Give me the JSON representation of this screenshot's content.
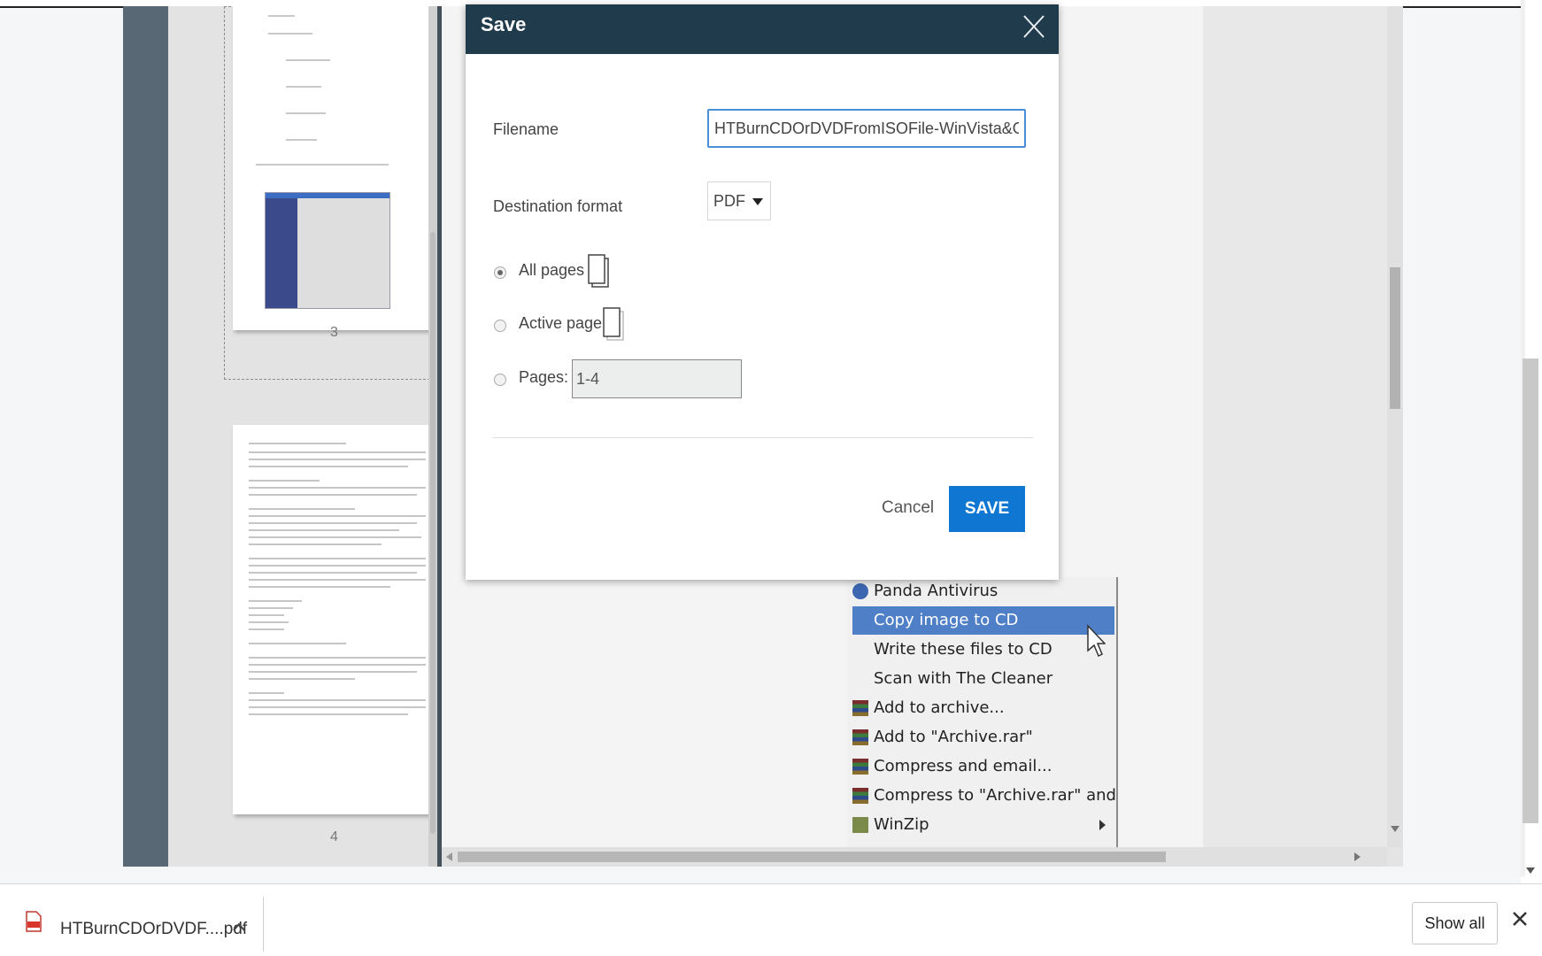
{
  "dialog": {
    "title": "Save",
    "filename_label": "Filename",
    "filename_value": "HTBurnCDOrDVDFromISOFile-WinVista&OlderOpSy",
    "format_label": "Destination format",
    "format_value": "PDF",
    "options": [
      {
        "label": "All pages",
        "selected": true
      },
      {
        "label": "Active page",
        "selected": false
      },
      {
        "label": "Pages:",
        "selected": false
      }
    ],
    "pages_value": "1-4",
    "cancel_label": "Cancel",
    "save_label": "SAVE"
  },
  "thumbnails": {
    "page3": "3",
    "page4": "4"
  },
  "context_menu": {
    "items": [
      {
        "label": "Panda Antivirus",
        "icon": "panda-icon"
      },
      {
        "label": "Copy image to CD",
        "highlighted": true
      },
      {
        "label": "Write these files to CD"
      },
      {
        "label": "Scan with The Cleaner"
      },
      {
        "label": "Add to archive...",
        "icon": "winrar-icon"
      },
      {
        "label": "Add to \"Archive.rar\"",
        "icon": "winrar-icon"
      },
      {
        "label": "Compress and email...",
        "icon": "winrar-icon"
      },
      {
        "label": "Compress to \"Archive.rar\" and email",
        "icon": "winrar-icon"
      },
      {
        "label": "WinZip",
        "icon": "winzip-icon",
        "submenu": true
      }
    ]
  },
  "download_bar": {
    "file_name": "HTBurnCDOrDVDF....pdf",
    "show_all_label": "Show all"
  },
  "colors": {
    "dialog_header": "#203c4c",
    "save_button": "#0f76d1",
    "input_focus": "#4a8fd8",
    "menu_highlight": "#4f7fc7"
  }
}
